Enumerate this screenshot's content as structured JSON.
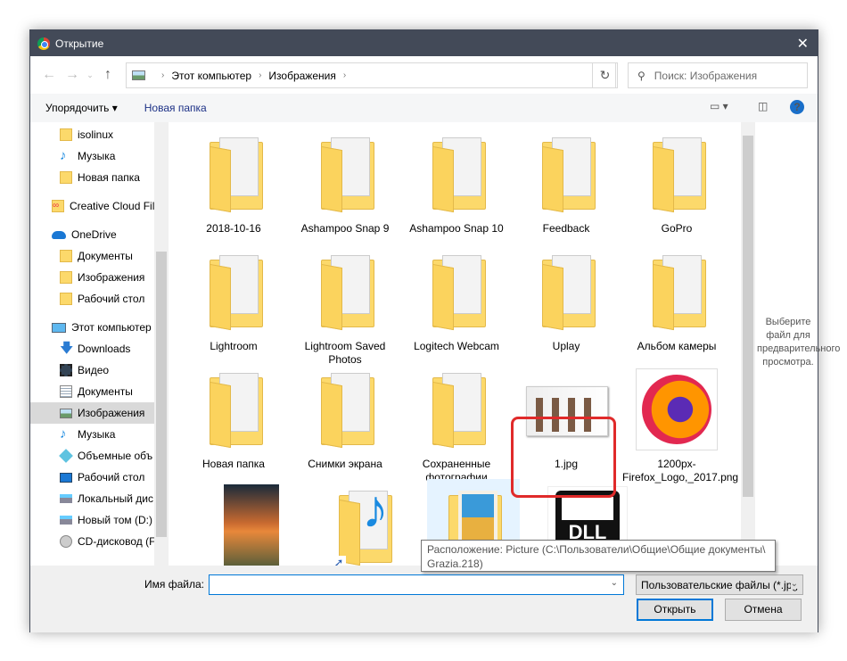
{
  "window": {
    "title": "Открытие"
  },
  "address": {
    "segments": [
      "Этот компьютер",
      "Изображения"
    ]
  },
  "search": {
    "placeholder": "Поиск: Изображения"
  },
  "toolbar": {
    "organize": "Упорядочить ▾",
    "new_folder": "Новая папка"
  },
  "sidebar": {
    "items": [
      {
        "label": "isolinux",
        "icon": "folder",
        "indent": 2
      },
      {
        "label": "Музыка",
        "icon": "music",
        "indent": 2
      },
      {
        "label": "Новая папка",
        "icon": "folder",
        "indent": 2
      },
      {
        "label": "Creative Cloud Fil",
        "icon": "creative-cloud",
        "indent": 1
      },
      {
        "label": "OneDrive",
        "icon": "cloud",
        "indent": 1
      },
      {
        "label": "Документы",
        "icon": "folder",
        "indent": 2
      },
      {
        "label": "Изображения",
        "icon": "folder",
        "indent": 2
      },
      {
        "label": "Рабочий стол",
        "icon": "folder",
        "indent": 2
      },
      {
        "label": "Этот компьютер",
        "icon": "computer",
        "indent": 1
      },
      {
        "label": "Downloads",
        "icon": "download",
        "indent": 2
      },
      {
        "label": "Видео",
        "icon": "video",
        "indent": 2
      },
      {
        "label": "Документы",
        "icon": "document",
        "indent": 2
      },
      {
        "label": "Изображения",
        "icon": "pictures",
        "indent": 2,
        "selected": true
      },
      {
        "label": "Музыка",
        "icon": "music",
        "indent": 2
      },
      {
        "label": "Объемные объ",
        "icon": "3d-objects",
        "indent": 2
      },
      {
        "label": "Рабочий стол",
        "icon": "desktop",
        "indent": 2
      },
      {
        "label": "Локальный дис",
        "icon": "drive",
        "indent": 2
      },
      {
        "label": "Новый том (D:)",
        "icon": "drive",
        "indent": 2
      },
      {
        "label": "CD-дисковод (F:",
        "icon": "cd-drive",
        "indent": 2
      }
    ]
  },
  "files": [
    {
      "name": "2018-10-16",
      "type": "folder"
    },
    {
      "name": "Ashampoo Snap 9",
      "type": "folder"
    },
    {
      "name": "Ashampoo Snap 10",
      "type": "folder"
    },
    {
      "name": "Feedback",
      "type": "folder"
    },
    {
      "name": "GoPro",
      "type": "folder"
    },
    {
      "name": "Lightroom",
      "type": "folder"
    },
    {
      "name": "Lightroom Saved Photos",
      "type": "folder"
    },
    {
      "name": "Logitech Webcam",
      "type": "folder"
    },
    {
      "name": "Uplay",
      "type": "folder"
    },
    {
      "name": "Альбом камеры",
      "type": "folder"
    },
    {
      "name": "Новая папка",
      "type": "folder"
    },
    {
      "name": "Снимки экрана",
      "type": "folder"
    },
    {
      "name": "Сохраненные фотографии",
      "type": "folder"
    },
    {
      "name": "1.jpg",
      "type": "image",
      "highlighted": true
    },
    {
      "name": "1200px-Firefox_Logo,_2017.png",
      "type": "firefox-image"
    },
    {
      "name": "",
      "type": "photo"
    },
    {
      "name": "",
      "type": "music-shortcut"
    },
    {
      "name": "",
      "type": "picture-shortcut",
      "selected": true
    },
    {
      "name": "",
      "type": "dll"
    }
  ],
  "preview": {
    "text": "Выберите файл для предварительного просмотра."
  },
  "tooltip": {
    "line1": "Расположение: Picture (C:\\Пользователи\\Общие\\Общие документы\\",
    "line2": "Grazia.218)"
  },
  "bottom": {
    "filename_label": "Имя файла:",
    "filename_value": "",
    "filetype": "Пользовательские файлы (*.jpg",
    "open": "Открыть",
    "cancel": "Отмена"
  },
  "colors": {
    "titlebar": "#434a58",
    "accent": "#0078d7",
    "highlight": "#e02a2a"
  }
}
